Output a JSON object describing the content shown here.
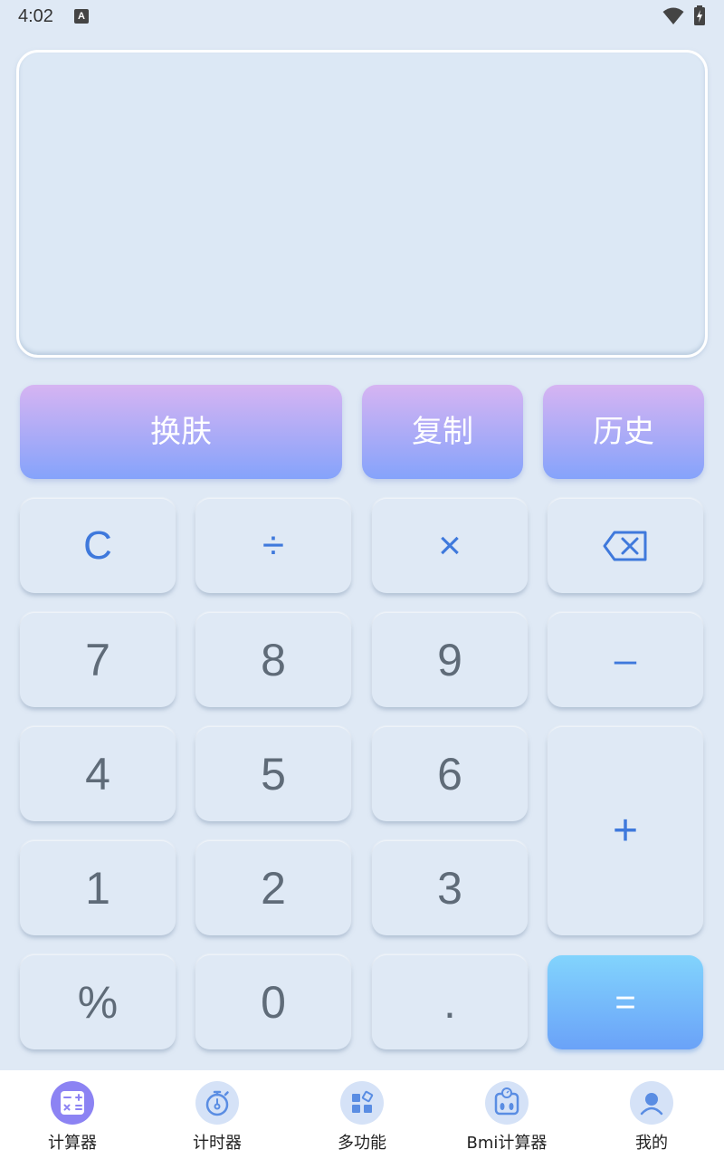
{
  "status_bar": {
    "time": "4:02",
    "notification_letter": "A"
  },
  "display": {
    "value": ""
  },
  "top_buttons": {
    "skin": "换肤",
    "copy": "复制",
    "history": "历史"
  },
  "keys": {
    "clear": "C",
    "divide": "÷",
    "multiply": "×",
    "seven": "7",
    "eight": "8",
    "nine": "9",
    "minus": "–",
    "four": "4",
    "five": "5",
    "six": "6",
    "plus": "+",
    "one": "1",
    "two": "2",
    "three": "3",
    "percent": "%",
    "zero": "0",
    "dot": ".",
    "equals": "="
  },
  "bottom_nav": {
    "items": [
      {
        "label": "计算器",
        "icon": "calculator-icon",
        "active": true
      },
      {
        "label": "计时器",
        "icon": "stopwatch-icon",
        "active": false
      },
      {
        "label": "多功能",
        "icon": "apps-grid-icon",
        "active": false
      },
      {
        "label": "Bmi计算器",
        "icon": "bmi-scale-icon",
        "active": false
      },
      {
        "label": "我的",
        "icon": "user-profile-icon",
        "active": false
      }
    ]
  },
  "colors": {
    "background": "#dfe9f5",
    "operator": "#3f79dc",
    "number": "#5f6b78",
    "top_button_gradient": [
      "#d6b4f2",
      "#85a3fb"
    ],
    "equals_gradient": [
      "#82d4fd",
      "#6aa2f8"
    ],
    "active_nav": "#8c83f3"
  }
}
